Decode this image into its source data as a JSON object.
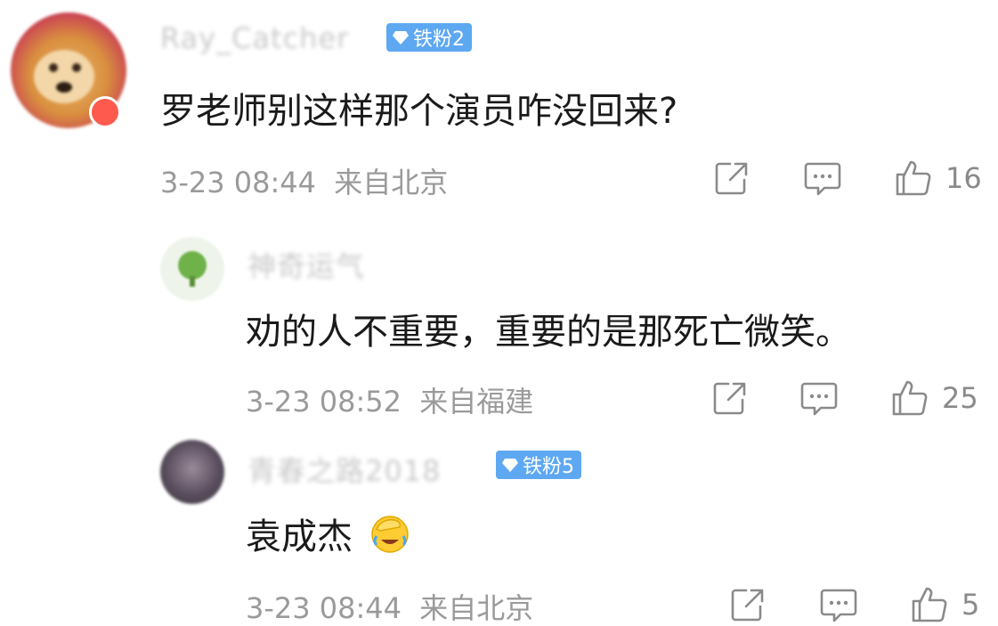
{
  "comments": [
    {
      "username": "Ray_Catcher",
      "badge": "铁粉2",
      "text": "罗老师别这样那个演员咋没回来?",
      "time": "3-23 08:44",
      "location": "来自北京",
      "likes": "16"
    },
    {
      "username": "神奇运气",
      "text": "劝的人不重要，重要的是那死亡微笑。",
      "time": "3-23 08:52",
      "location": "来自福建",
      "likes": "25"
    },
    {
      "username": "青春之路2018",
      "badge": "铁粉5",
      "text": "袁成杰",
      "time": "3-23 08:44",
      "location": "来自北京",
      "likes": "5"
    }
  ],
  "icons": {
    "share": "share-icon",
    "comment": "comment-icon",
    "like": "thumbs-up-icon",
    "emoji": "facepalm-cry-emoji"
  },
  "colors": {
    "badge": "#5ea8f2",
    "meta": "#9a9a9a",
    "text": "#1a1a1a"
  }
}
